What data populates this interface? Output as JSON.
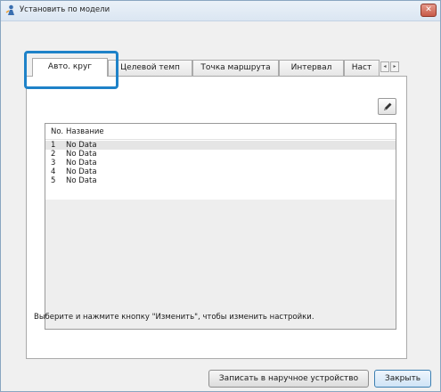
{
  "window": {
    "title": "Установить по модели",
    "close_label": "✕"
  },
  "tabs": [
    {
      "label": "Авто. круг",
      "active": true
    },
    {
      "label": "Целевой темп",
      "active": false
    },
    {
      "label": "Точка маршрута",
      "active": false
    },
    {
      "label": "Интервал",
      "active": false
    },
    {
      "label": "Наст",
      "active": false
    }
  ],
  "tab_scroll": {
    "left": "◂",
    "right": "▸"
  },
  "list": {
    "columns": [
      "No.",
      "Название"
    ],
    "rows": [
      {
        "no": "1",
        "name": "No Data"
      },
      {
        "no": "2",
        "name": "No Data"
      },
      {
        "no": "3",
        "name": "No Data"
      },
      {
        "no": "4",
        "name": "No Data"
      },
      {
        "no": "5",
        "name": "No Data"
      }
    ]
  },
  "info_text": "Выберите и нажмите кнопку \"Изменить\", чтобы изменить настройки.",
  "buttons": {
    "write": "Записать в наручное устройство",
    "close": "Закрыть"
  },
  "icons": {
    "app": "app-person-icon",
    "edit": "pencil-icon"
  },
  "colors": {
    "highlight": "#1e82c8"
  }
}
